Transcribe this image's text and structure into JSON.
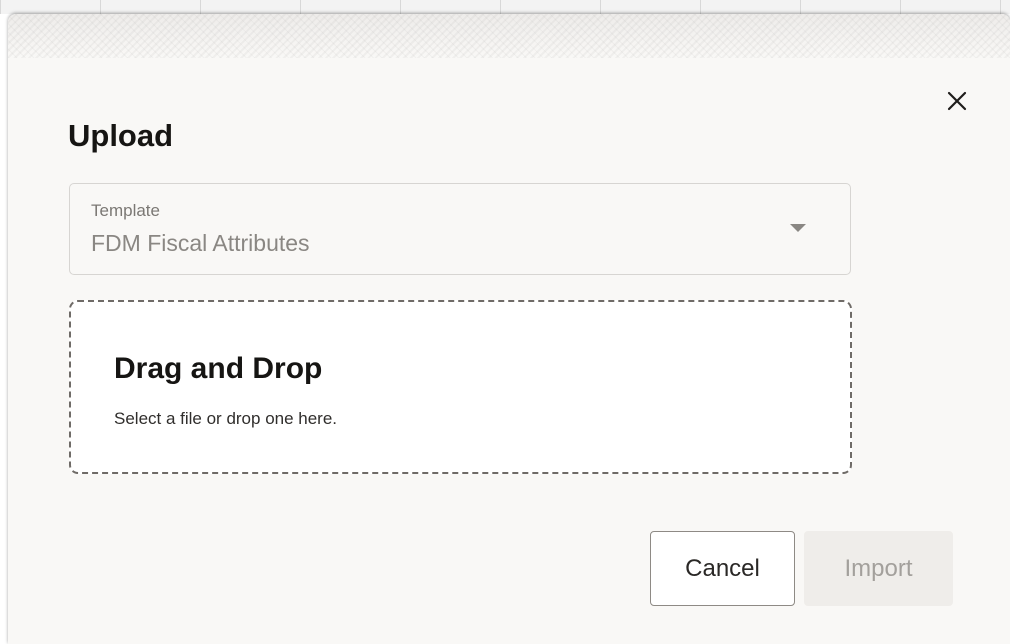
{
  "dialog": {
    "title": "Upload",
    "close_icon": "close-icon"
  },
  "template_select": {
    "label": "Template",
    "value": "FDM Fiscal Attributes",
    "caret_icon": "caret-down-icon"
  },
  "dropzone": {
    "title": "Drag and Drop",
    "subtitle": "Select a file or drop one here."
  },
  "actions": {
    "cancel_label": "Cancel",
    "import_label": "Import",
    "import_enabled": false
  },
  "colors": {
    "dialog_bg": "#f9f8f6",
    "text_primary": "#161513",
    "disabled_text": "#a3a09c",
    "disabled_bg": "#efedea"
  }
}
